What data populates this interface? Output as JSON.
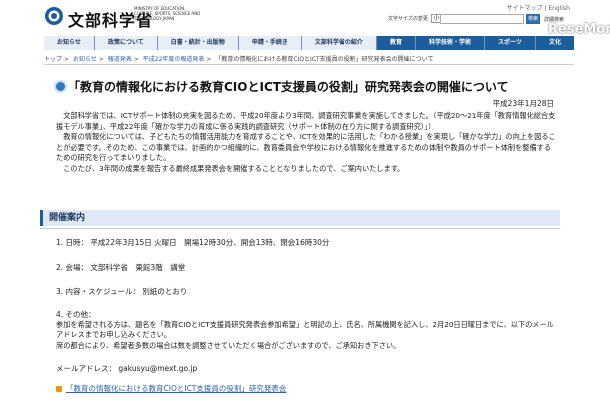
{
  "header": {
    "logo_text": "文部科学省",
    "logo_sub": "MINISTRY OF EDUCATION, CULTURE, SPORTS, SCIENCE AND TECHNOLOGY-JAPAN",
    "top_links": "サイトマップ | English",
    "font_size_label": "文字サイズの変更",
    "font_size_small": "小",
    "font_size_medium": "中",
    "font_size_large": "大",
    "search_placeholder": "",
    "search_button": "検索",
    "advanced_search": "詳細検索",
    "watermark": "ReseMom"
  },
  "nav": {
    "items": [
      {
        "label": "お知らせ"
      },
      {
        "label": "政策について"
      },
      {
        "label": "白書・統計・出版物"
      },
      {
        "label": "申請・手続き"
      },
      {
        "label": "文部科学省の紹介"
      },
      {
        "label": "教育"
      },
      {
        "label": "科学技術・学術"
      },
      {
        "label": "スポーツ"
      },
      {
        "label": "文化"
      }
    ]
  },
  "breadcrumb": {
    "items": [
      "トップ",
      "お知らせ",
      "報道発表",
      "平成22年度の報道発表"
    ],
    "current": "「教育の情報化における教育CIOとICT支援員の役割」研究発表会の開催について"
  },
  "page": {
    "title": "「教育の情報化における教育CIOとICT支援員の役割」研究発表会の開催について",
    "date": "平成23年1月28日",
    "intro": [
      "文部科学省では、ICTサポート体制の充実を図るため、平成20年度より3年間、調査研究事業を実施してきました。（平成20～21年度「教育情報化総合支援モデル事業」、平成22年度「確かな学力の育成に係る実践的調査研究（サポート体制の在り方に関する調査研究）」）",
      "教育の情報化については、子どもたちの情報活用能力を育成することや、ICTを効果的に活用した「わかる授業」を実現し「確かな学力」の向上を図ることが必要です。そのため、この事業では、計画的かつ組織的に、教育委員会や学校における情報化を推進するための体制や教員のサポート体制を整備するための研究を行ってまいりました。",
      "このたび、3年間の成果を報告する最終成果発表会を開催することとなりましたので、ご案内いたします。"
    ]
  },
  "section": {
    "title": "開催案内",
    "item1": "1. 日時： 平成22年3月15日 火曜日　開場12時30分、開会13時、閉会16時30分",
    "item2": "2. 会場： 文部科学省　東館3階　講堂",
    "item3": "3. 内容・スケジュール： 別紙のとおり",
    "item4": "4. その他：",
    "note": "参加を希望される方は、題名を「教育CIOとICT支援員研究発表会参加希望」と明記の上、氏名、所属機関を記入し、2月20日日曜日までに、以下のメールアドレスまでお申し込みください。",
    "note2": "席の都合により、希望者多数の場合は数を調整させていただく場合がございますので、ご承知おき下さい。",
    "mail_label": "メールアドレス：",
    "mail_value": "gakusyu@mext.go.jp",
    "footer_link": "「教育の情報化における教育CIOとICT支援員の役割」研究発表会"
  },
  "colors": {
    "nav_blue": "#1e5d9c",
    "nav_light": "#e7eef6",
    "link_blue": "#2f5fa6",
    "section_bg": "#dfe8f4"
  }
}
